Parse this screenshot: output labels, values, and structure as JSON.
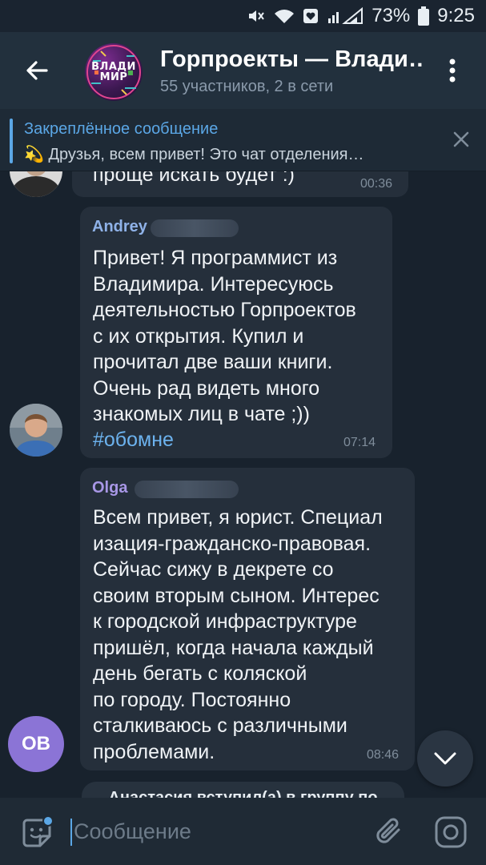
{
  "status_bar": {
    "battery_percent": "73%",
    "time": "9:25",
    "icons": [
      "mute-icon",
      "wifi-icon",
      "heart-box-icon",
      "signal-icon",
      "battery-icon"
    ]
  },
  "header": {
    "avatar_text_line1": "ВЛАДИ",
    "avatar_text_line2": "МИР",
    "title": "Горпроекты — Влади…",
    "subtitle": "55 участников, 2 в сети"
  },
  "pinned": {
    "label": "Закреплённое сообщение",
    "emoji": "💫",
    "text": "Друзья, всем привет!   Это чат отделения…"
  },
  "messages": [
    {
      "text": "проще искать будет :)",
      "time": "00:36"
    },
    {
      "sender": "Andrey",
      "sender_color": "#8fb2e8",
      "text": "Привет! Я программист из\nВладимира. Интересуюсь\nдеятельностью Горпроектов\nс их открытия. Купил и\nпрочитал две ваши книги.\nОчень рад видеть много\nзнакомых лиц в чате ;))",
      "hashtag": "#обомне",
      "time": "07:14"
    },
    {
      "sender": "Olga",
      "sender_color": "#a897e6",
      "avatar_initials": "OB",
      "text": "Всем привет, я юрист. Специал\nизация-гражданско-правовая.\nСейчас сижу в декрете со\nсвоим вторым сыном. Интерес\nк городской инфраструктуре\nпришёл, когда начала каждый\nдень бегать с коляской\nпо городу. Постоянно\nсталкиваюсь с различными\nпроблемами.",
      "time": "08:46"
    }
  ],
  "service_message": "Анастасия вступил(а) в группу по",
  "input": {
    "placeholder": "Сообщение"
  },
  "colors": {
    "background": "#18222d",
    "bubble": "#252f3b",
    "accent": "#5ba7e6",
    "header": "#22303d"
  }
}
